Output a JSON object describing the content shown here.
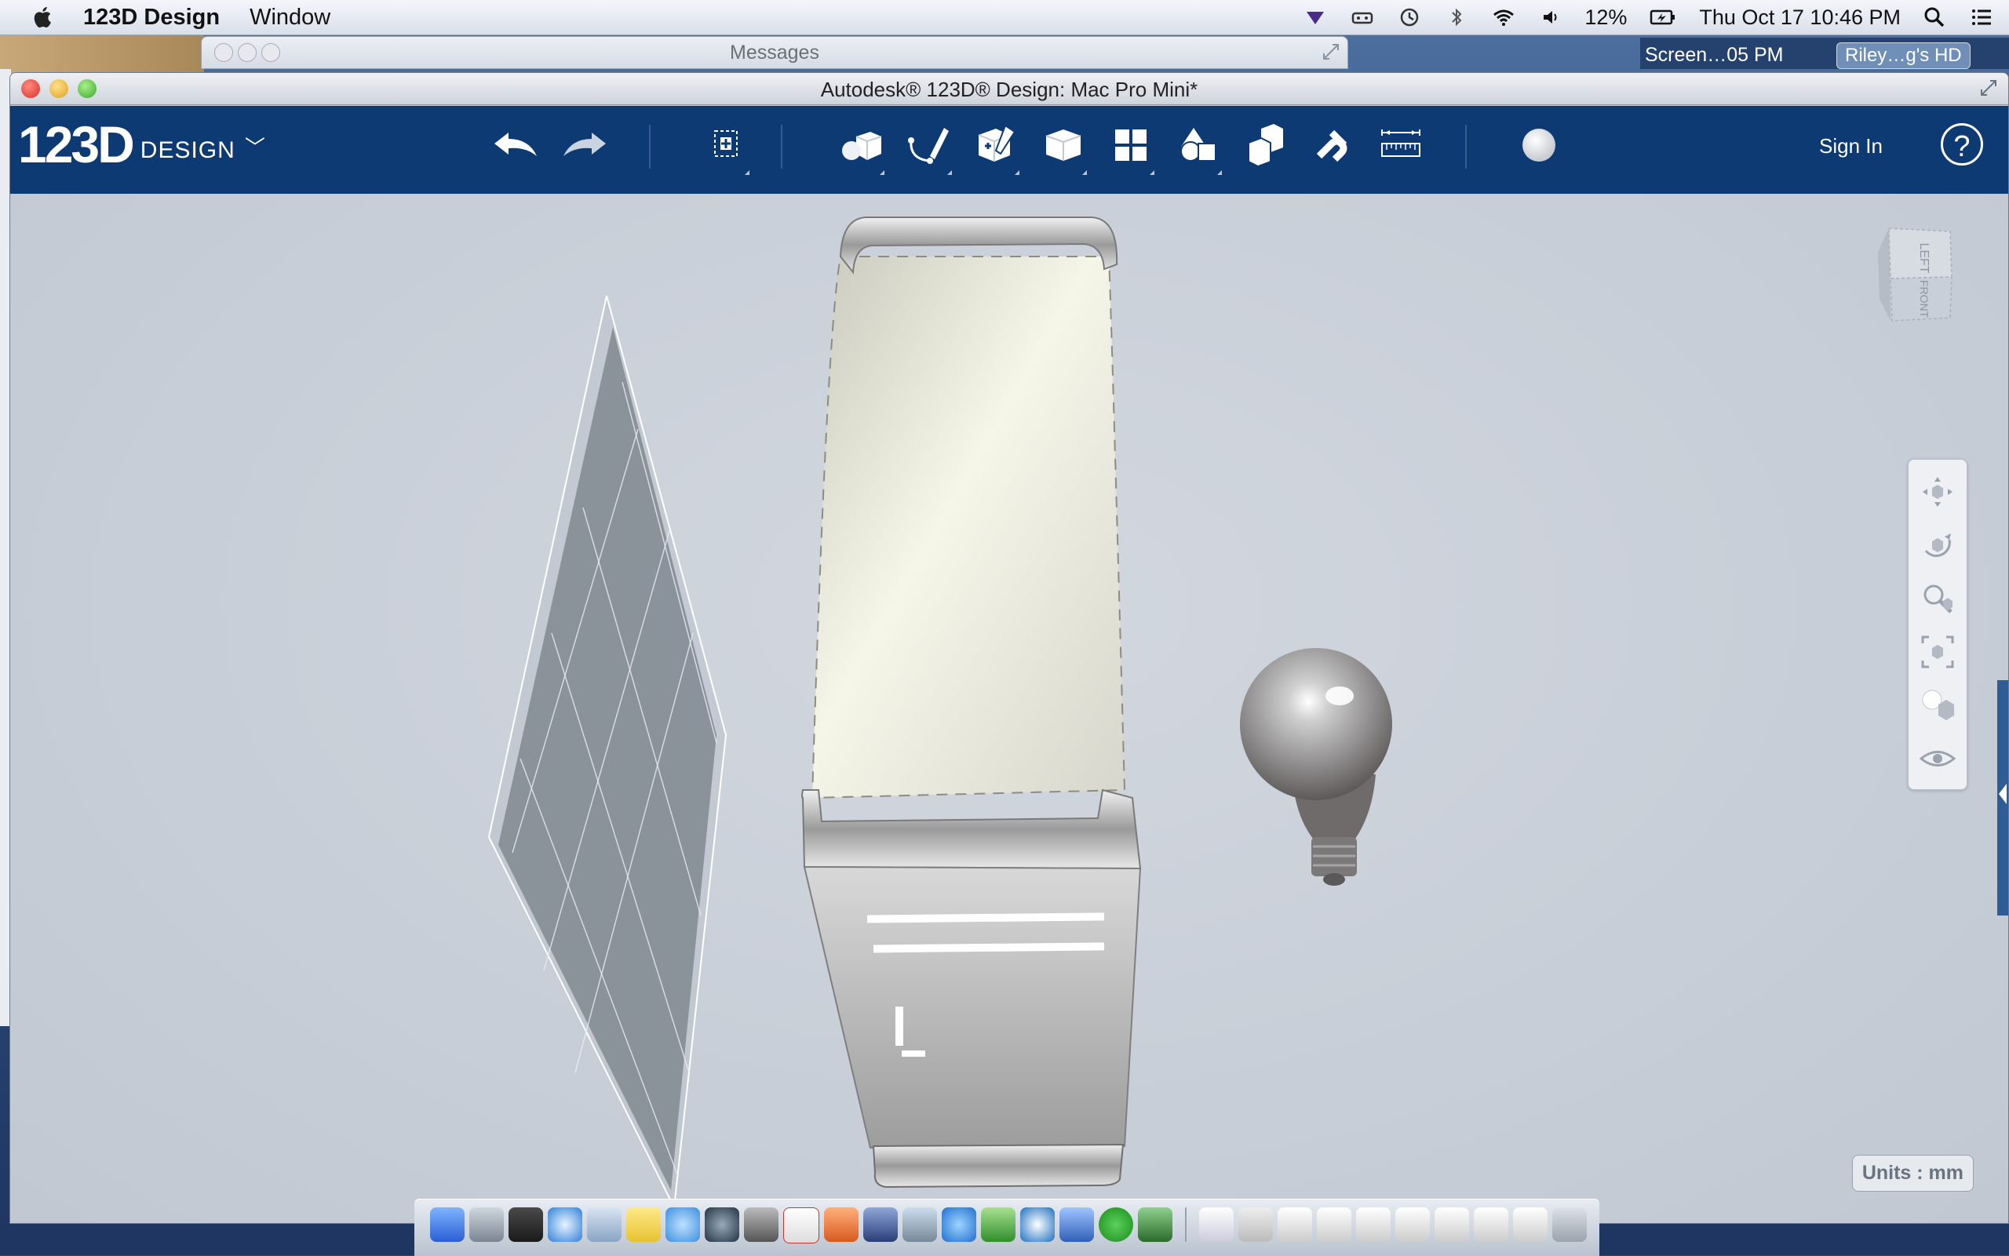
{
  "menubar": {
    "app_name": "123D Design",
    "menu_window": "Window",
    "battery": "12%",
    "datetime": "Thu Oct 17  10:46 PM",
    "icons": [
      "apple-icon",
      "wifi-icon",
      "volume-icon",
      "battery-icon",
      "search-icon",
      "list-icon",
      "bluetooth-icon",
      "time-machine-icon"
    ]
  },
  "background_windows": {
    "messages_title": "Messages",
    "screenshot_label": "Screen…05 PM",
    "hd_label": "Riley…g's HD"
  },
  "window": {
    "title": "Autodesk® 123D® Design: Mac Pro Mini*"
  },
  "toolbar": {
    "logo_number": "123D",
    "logo_word": "DESIGN",
    "sign_in": "Sign In",
    "help": "?",
    "tools": [
      "undo",
      "redo",
      "transform",
      "primitives",
      "sketch",
      "construct",
      "modify",
      "pattern",
      "grouping",
      "combine",
      "snap",
      "measure",
      "material"
    ]
  },
  "viewport": {
    "units": "Units : mm",
    "viewcube_top": "LEFT",
    "viewcube_front": "FRONT"
  },
  "colors": {
    "toolbar": "#0e3a74",
    "viewport": "#c6ccd6",
    "accent": "#2f5c92"
  }
}
